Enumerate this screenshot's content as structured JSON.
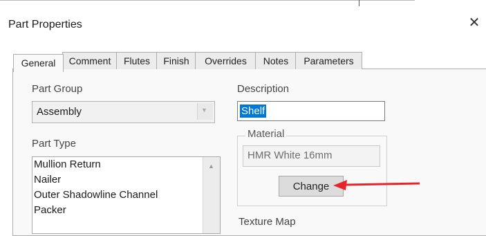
{
  "dialog": {
    "title": "Part Properties",
    "close_glyph": "✕"
  },
  "tabs": [
    {
      "label": "General",
      "active": true
    },
    {
      "label": "Comment",
      "active": false
    },
    {
      "label": "Flutes",
      "active": false
    },
    {
      "label": "Finish",
      "active": false
    },
    {
      "label": "Overrides",
      "active": false
    },
    {
      "label": "Notes",
      "active": false
    },
    {
      "label": "Parameters",
      "active": false
    }
  ],
  "general": {
    "part_group": {
      "label": "Part Group",
      "value": "Assembly"
    },
    "part_type": {
      "label": "Part Type",
      "items": [
        "Mullion Return",
        "Nailer",
        "Outer Shadowline Channel",
        "Packer"
      ]
    },
    "description": {
      "label": "Description",
      "value": "Shelf"
    },
    "material": {
      "label": "Material",
      "value": "HMR White 16mm",
      "change_label": "Change"
    },
    "texture_map": {
      "label": "Texture Map"
    }
  },
  "icons": {
    "combo_dropdown": "chevron-down-icon",
    "scroll_up": "triangle-up-icon",
    "annotation": "red-arrow"
  },
  "colors": {
    "selection": "#0078d7",
    "annotation_arrow": "#e8242b"
  }
}
